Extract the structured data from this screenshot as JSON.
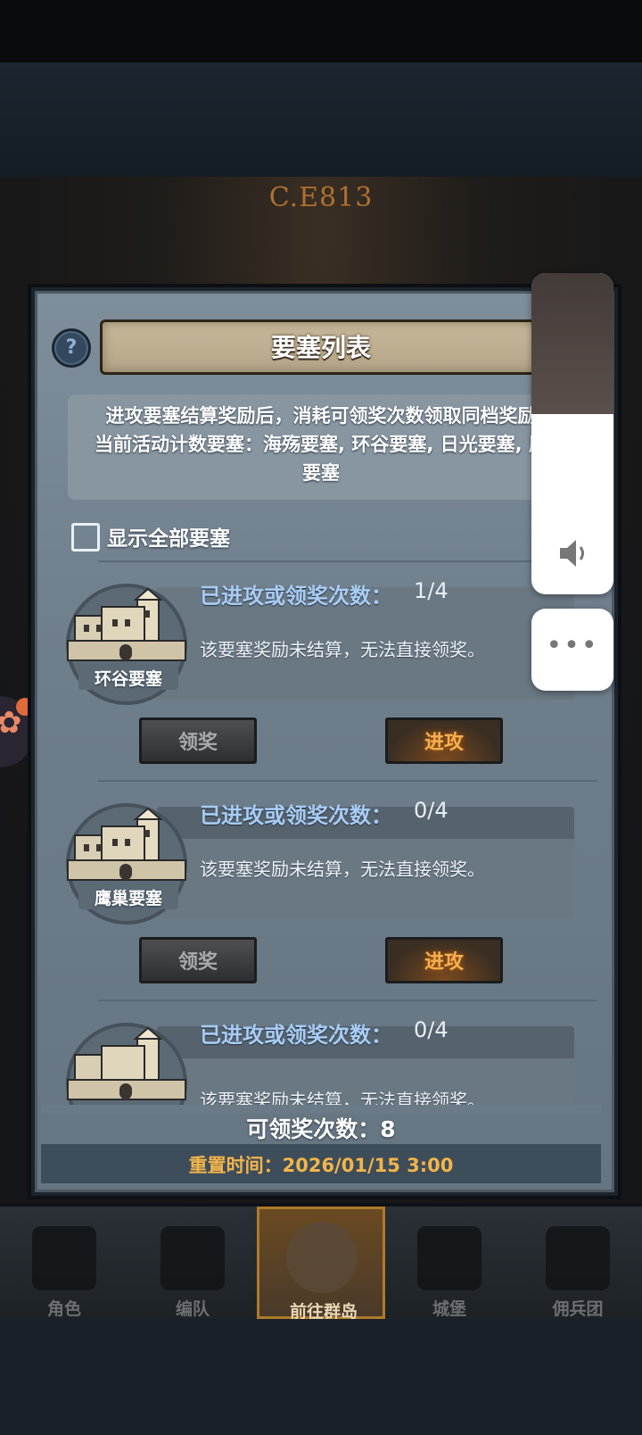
{
  "year_label": "C.E813",
  "panel": {
    "help_glyph": "?",
    "title": "要塞列表",
    "description_line1": "进攻要塞结算奖励后，消耗可领奖次数领取同档奖励",
    "description_line2": "当前活动计数要塞：海殇要塞, 环谷要塞, 日光要塞, 鹰",
    "description_line3": "要塞",
    "show_all_label": "显示全部要塞",
    "show_all_checked": false
  },
  "fortresses": [
    {
      "name": "环谷要塞",
      "count_label": "已进攻或领奖次数：",
      "count_value": "1/4",
      "status": "该要塞奖励未结算，无法直接领奖。",
      "claim_label": "领奖",
      "attack_label": "进攻"
    },
    {
      "name": "鹰巢要塞",
      "count_label": "已进攻或领奖次数：",
      "count_value": "0/4",
      "status": "该要塞奖励未结算，无法直接领奖。",
      "claim_label": "领奖",
      "attack_label": "进攻"
    },
    {
      "name": "",
      "count_label": "已进攻或领奖次数：",
      "count_value": "0/4",
      "status": "该要塞奖励未结算，无法直接领奖。",
      "claim_label": "",
      "attack_label": ""
    }
  ],
  "footer": {
    "claimable_label": "可领奖次数：8",
    "reset_label": "重置时间：2026/01/15 3:00"
  },
  "nav": {
    "items": [
      {
        "label": "角色",
        "icon": "character-icon"
      },
      {
        "label": "编队",
        "icon": "formation-icon"
      },
      {
        "label": "前往群岛",
        "icon": "islands-icon"
      },
      {
        "label": "城堡",
        "icon": "castle-icon"
      },
      {
        "label": "佣兵团",
        "icon": "mercenary-icon"
      }
    ],
    "active_index": 2
  },
  "overlay": {
    "more_glyph": "•••"
  },
  "colors": {
    "accent_gold": "#f2b54a",
    "attack_text": "#f4b050",
    "count_label": "#a8ccf4",
    "panel_bg": "#7f8e9b"
  }
}
